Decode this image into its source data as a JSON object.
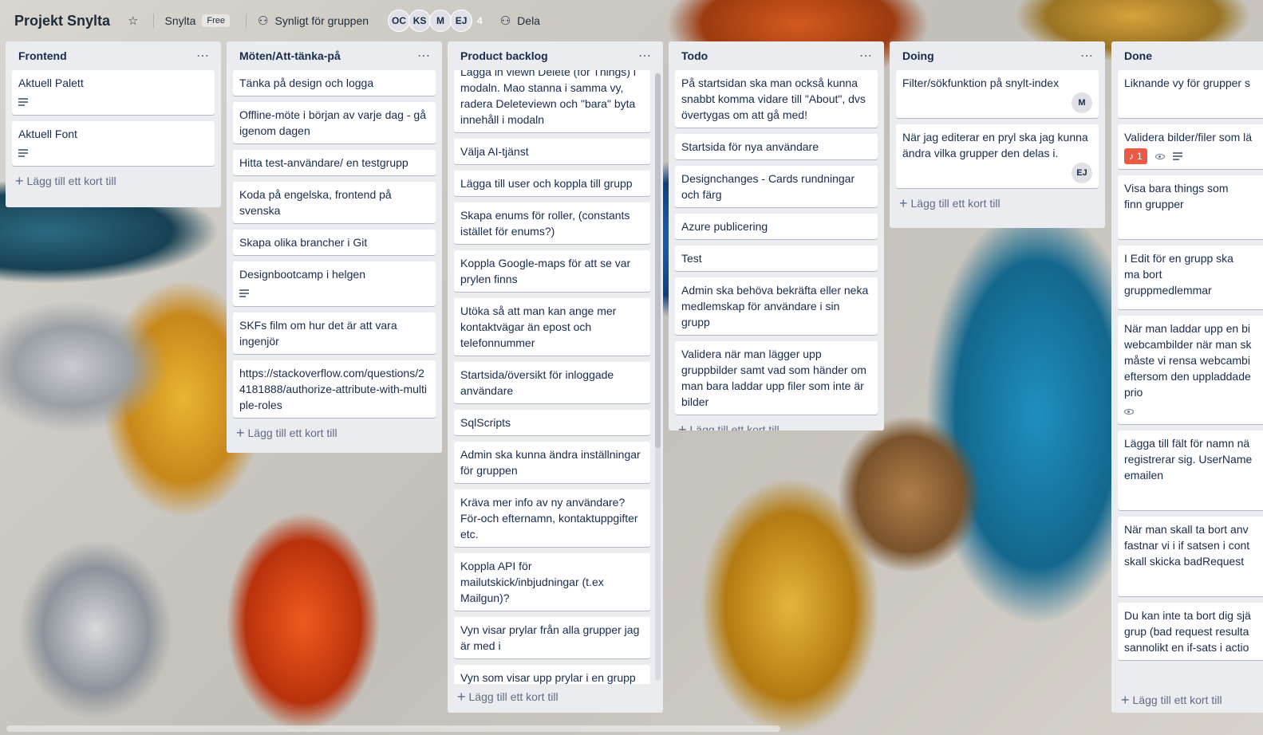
{
  "board": {
    "title": "Projekt Snylta",
    "workspace": "Snylta",
    "plan": "Free",
    "visibility": "Synligt för gruppen",
    "members": [
      "OC",
      "KS",
      "M",
      "EJ"
    ],
    "member_count": "4",
    "share_label": "Dela"
  },
  "add_card_label": "Lägg till ett kort till",
  "lists": [
    {
      "title": "Frontend",
      "cards": [
        {
          "text": "Aktuell Palett"
        },
        {
          "text": "Aktuell Font"
        }
      ]
    },
    {
      "title": "Möten/Att-tänka-på",
      "cards": [
        {
          "text": "Tänka på design och logga"
        },
        {
          "text": "Offline-möte i början av varje dag - gå igenom dagen"
        },
        {
          "text": "Hitta test-användare/ en testgrupp"
        },
        {
          "text": "Koda på engelska, frontend på svenska"
        },
        {
          "text": "Skapa olika brancher i Git"
        },
        {
          "text": "Designbootcamp i helgen"
        },
        {
          "text": "SKFs film om hur det är att vara ingenjör"
        },
        {
          "text": "https://stackoverflow.com/questions/24181888/authorize-attribute-with-multiple-roles"
        }
      ]
    },
    {
      "title": "Product backlog",
      "cards": [
        {
          "text": "Lägga in viewn Delete (för Things) i modaln. Mao stanna i samma vy, radera Deleteviewn och \"bara\" byta innehåll i modaln"
        },
        {
          "text": "Välja AI-tjänst"
        },
        {
          "text": "Lägga till user och koppla till grupp"
        },
        {
          "text": "Skapa enums för roller, (constants istället för enums?)"
        },
        {
          "text": "Koppla Google-maps för att se var prylen finns"
        },
        {
          "text": "Utöka så att man kan ange mer kontaktvägar än epost och telefonnummer"
        },
        {
          "text": "Startsida/översikt för inloggade användare"
        },
        {
          "text": "SqlScripts"
        },
        {
          "text": "Admin ska kunna ändra inställningar för gruppen"
        },
        {
          "text": "Kräva mer info av ny användare? För-och efternamn, kontaktuppgifter etc."
        },
        {
          "text": "Koppla API för mailutskick/inbjudningar (t.ex Mailgun)?"
        },
        {
          "text": "Vyn visar prylar från alla grupper jag är med i"
        },
        {
          "text": "Vyn som visar upp prylar i en grupp"
        }
      ]
    },
    {
      "title": "Todo",
      "cards": [
        {
          "text": "På startsidan ska man också kunna snabbt komma vidare till \"About\", dvs övertygas om att gå med!"
        },
        {
          "text": "Startsida för nya användare"
        },
        {
          "text": "Designchanges - Cards rundningar och färg"
        },
        {
          "text": "Azure publicering"
        },
        {
          "text": "Test"
        },
        {
          "text": "Admin ska behöva bekräfta eller neka medlemskap för användare i sin grupp"
        },
        {
          "text": "Validera när man lägger upp gruppbilder samt vad som händer om man bara laddar upp filer som inte är bilder"
        }
      ]
    },
    {
      "title": "Doing",
      "cards": [
        {
          "text": "Filter/sökfunktion på snylt-index",
          "member": "M"
        },
        {
          "text": "När jag editerar en pryl ska jag kunna ändra vilka grupper den delas i.",
          "member": "EJ"
        }
      ]
    },
    {
      "title": "Done",
      "cards": [
        {
          "text": "Liknande vy för grupper s"
        },
        {
          "text": "Validera bilder/filer som lä",
          "alert": "1"
        },
        {
          "text": "Visa bara things som finn grupper"
        },
        {
          "text": "I Edit för en grupp ska ma bort gruppmedlemmar"
        },
        {
          "text": "När man laddar upp en bi webcambilder när man sk måste vi rensa webcambi eftersom den uppladdade prio"
        },
        {
          "text": "Lägga till fält för namn nä registrerar sig. UserName emailen"
        },
        {
          "text": "När man skall ta bort anv fastnar vi i if satsen i cont skall skicka badRequest"
        },
        {
          "text": "Du kan inte ta bort dig sjä grup (bad request resulta sannolikt en if-sats i actio"
        }
      ]
    }
  ]
}
